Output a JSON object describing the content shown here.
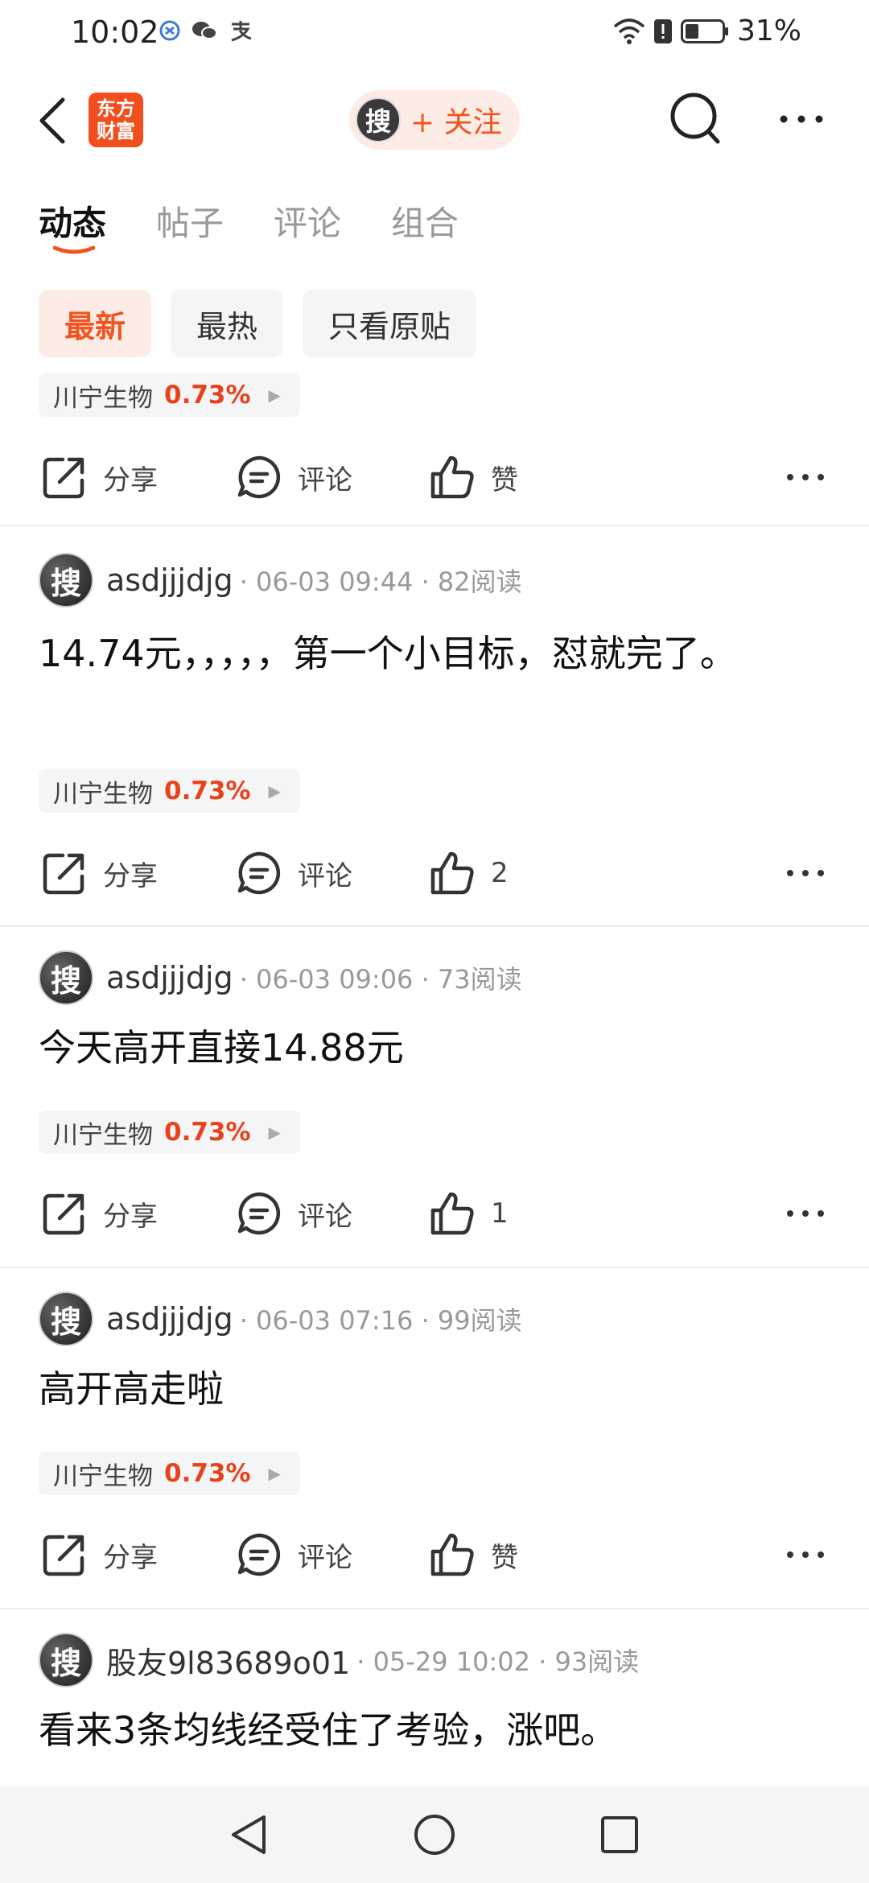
{
  "status_bar": {
    "time": "10:02",
    "battery": "31%"
  },
  "header": {
    "logo_line1": "东方",
    "logo_line2": "财富",
    "avatar_char": "搜",
    "follow_label": "+ 关注"
  },
  "tabs": [
    {
      "label": "动态",
      "active": true
    },
    {
      "label": "帖子",
      "active": false
    },
    {
      "label": "评论",
      "active": false
    },
    {
      "label": "组合",
      "active": false
    }
  ],
  "filters": [
    {
      "label": "最新",
      "active": true
    },
    {
      "label": "最热",
      "active": false
    },
    {
      "label": "只看原贴",
      "active": false
    }
  ],
  "posts": [
    {
      "author": "",
      "meta": "",
      "content": "",
      "stock": {
        "name": "川宁生物",
        "pct": "0.73%"
      },
      "share": "分享",
      "comment": "评论",
      "like": "赞"
    },
    {
      "author": "asdjjjdjg",
      "meta": "· 06-03 09:44 · 82阅读",
      "content": "14.74元，，，，，第一个小目标，怼就完了。",
      "stock": {
        "name": "川宁生物",
        "pct": "0.73%"
      },
      "share": "分享",
      "comment": "评论",
      "like": "2"
    },
    {
      "author": "asdjjjdjg",
      "meta": "· 06-03 09:06 · 73阅读",
      "content": "今天高开直接14.88元",
      "stock": {
        "name": "川宁生物",
        "pct": "0.73%"
      },
      "share": "分享",
      "comment": "评论",
      "like": "1"
    },
    {
      "author": "asdjjjdjg",
      "meta": "· 06-03 07:16 · 99阅读",
      "content": "高开高走啦",
      "stock": {
        "name": "川宁生物",
        "pct": "0.73%"
      },
      "share": "分享",
      "comment": "评论",
      "like": "赞"
    },
    {
      "author": "股友9l83689o01",
      "meta": "· 05-29 10:02 · 93阅读",
      "content": "看来3条均线经受住了考验，涨吧。",
      "stock": {
        "name": "",
        "pct": ""
      },
      "share": "",
      "comment": "",
      "like": ""
    }
  ],
  "colors": {
    "accent": "#f2541f",
    "pct_red": "#e8421b"
  }
}
